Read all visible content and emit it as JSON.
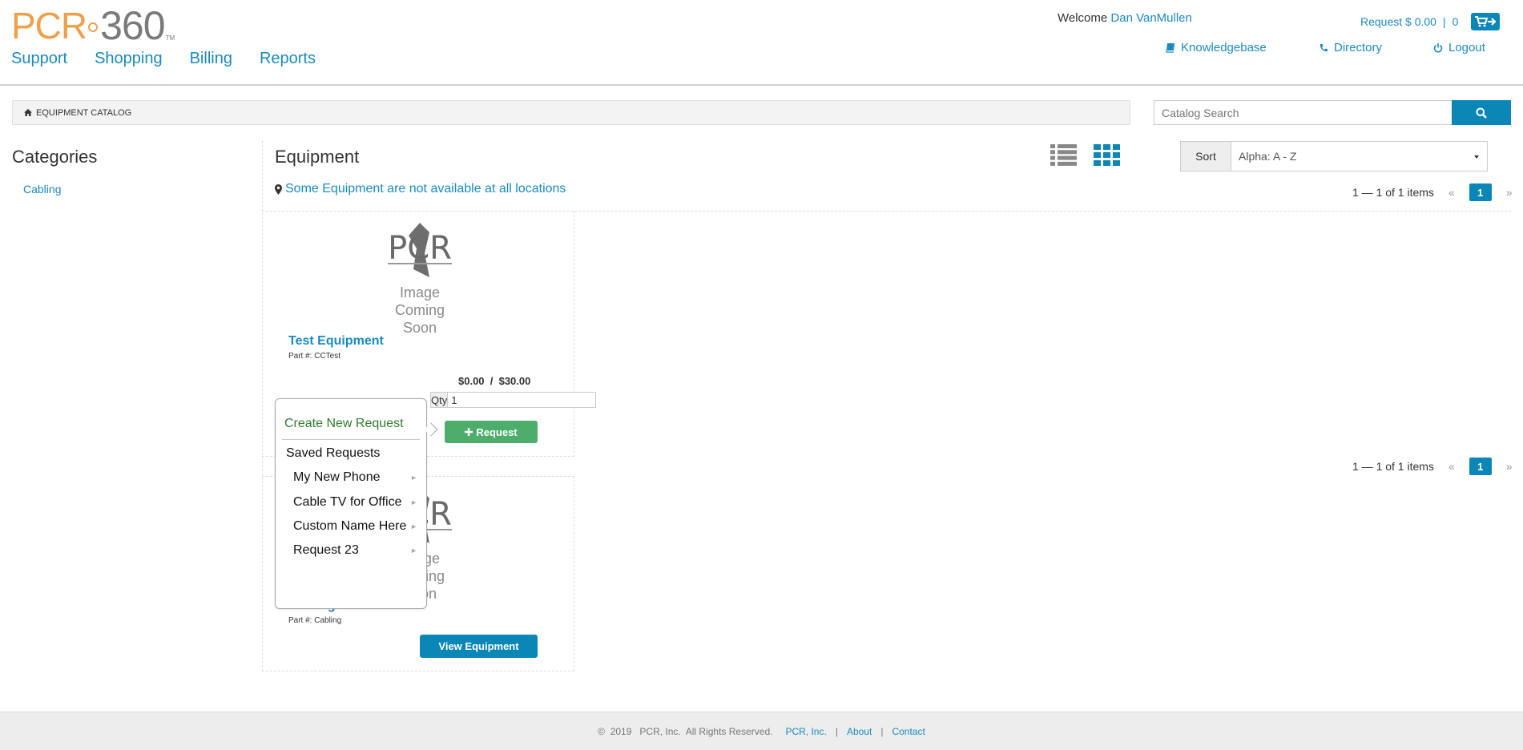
{
  "logo": {
    "brand": "PCR",
    "number": "360",
    "tm": "TM"
  },
  "nav": [
    "Support",
    "Shopping",
    "Billing",
    "Reports"
  ],
  "header": {
    "welcome": "Welcome",
    "user": "Dan VanMullen",
    "request_label": "Request $ 0.00",
    "cart_count": "0",
    "links": {
      "knowledgebase": "Knowledgebase",
      "directory": "Directory",
      "logout": "Logout"
    }
  },
  "breadcrumb": "EQUIPMENT CATALOG",
  "search": {
    "placeholder": "Catalog Search"
  },
  "sidebar": {
    "title": "Categories",
    "items": [
      "Cabling"
    ]
  },
  "main": {
    "title": "Equipment",
    "availability_note": "Some Equipment are not available at all locations",
    "sort_label": "Sort",
    "sort_value": "Alpha: A - Z",
    "pager_text": "1 — 1 of 1 items",
    "pager_prev": "«",
    "pager_page": "1",
    "pager_next": "»"
  },
  "placeholder": {
    "logo_text": "PCR",
    "line1": "Image",
    "line2": "Coming Soon"
  },
  "products": [
    {
      "name": "Test Equipment",
      "part": "Part #: CCTest",
      "price": "$0.00  /  $30.00",
      "qty_label": "Qty",
      "qty_value": "1",
      "button": "Request"
    },
    {
      "name": "Cabling",
      "part": "Part #: Cabling",
      "button": "View Equipment"
    }
  ],
  "popup": {
    "create": "Create New Request",
    "saved_title": "Saved Requests",
    "saved": [
      "My New Phone",
      "Cable TV for Office",
      "Custom Name Here",
      "Request 23"
    ]
  },
  "footer": {
    "copyright": "©  2019   PCR, Inc.  All Rights Reserved.",
    "links": [
      "PCR, Inc.",
      "About",
      "Contact"
    ]
  },
  "colors": {
    "brand_orange": "#f0a04b",
    "link_blue": "#1a8ac0",
    "primary": "#0a86b7",
    "success": "#4cae6a"
  }
}
